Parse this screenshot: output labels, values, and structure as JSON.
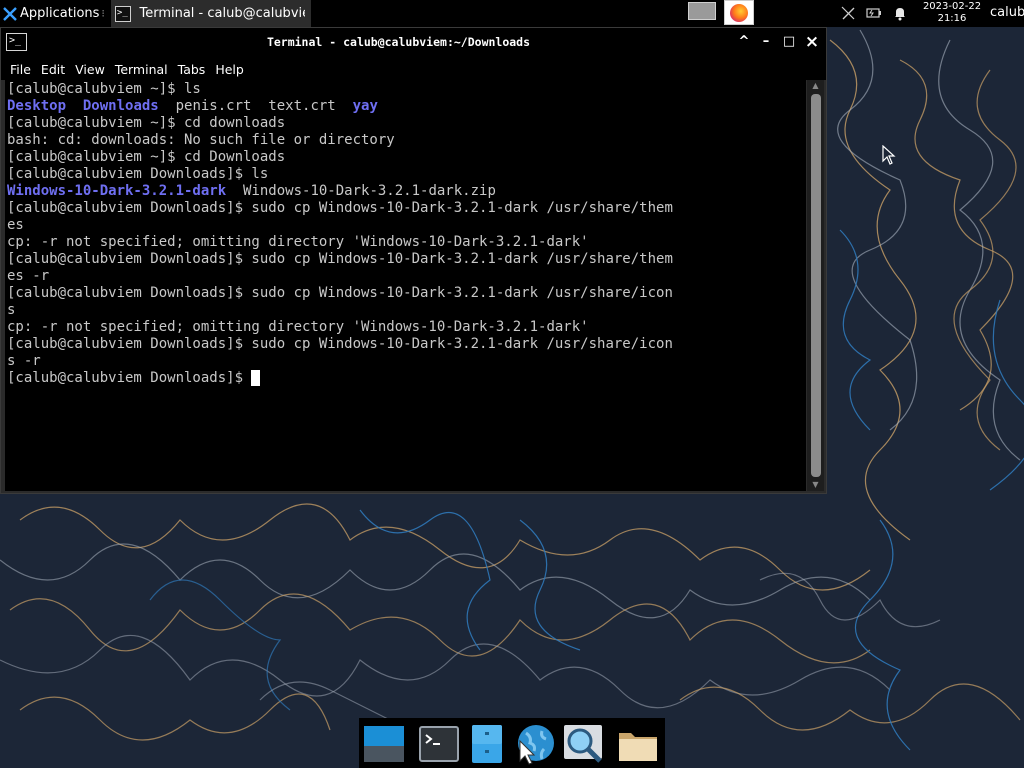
{
  "panel": {
    "applications_label": "Applications",
    "task_label": "Terminal - calub@calubvie...",
    "clock_date": "2023-02-22",
    "clock_time": "21:16",
    "user": "calub"
  },
  "window": {
    "title": "Terminal - calub@calubviem:~/Downloads",
    "menu": [
      "File",
      "Edit",
      "View",
      "Terminal",
      "Tabs",
      "Help"
    ],
    "controls": {
      "up": "^",
      "minimize": "–",
      "maximize": "□",
      "close": "×"
    }
  },
  "terminal": {
    "lines": [
      [
        {
          "t": "[calub@calubviem ~]$ ls",
          "c": "n"
        }
      ],
      [
        {
          "t": "Desktop",
          "c": "b"
        },
        {
          "t": "  ",
          "c": "n"
        },
        {
          "t": "Downloads",
          "c": "b"
        },
        {
          "t": "  penis.crt  text.crt  ",
          "c": "n"
        },
        {
          "t": "yay",
          "c": "b"
        }
      ],
      [
        {
          "t": "[calub@calubviem ~]$ cd downloads",
          "c": "n"
        }
      ],
      [
        {
          "t": "bash: cd: downloads: No such file or directory",
          "c": "n"
        }
      ],
      [
        {
          "t": "[calub@calubviem ~]$ cd Downloads",
          "c": "n"
        }
      ],
      [
        {
          "t": "[calub@calubviem Downloads]$ ls",
          "c": "n"
        }
      ],
      [
        {
          "t": "Windows-10-Dark-3.2.1-dark",
          "c": "b"
        },
        {
          "t": "  Windows-10-Dark-3.2.1-dark.zip",
          "c": "n"
        }
      ],
      [
        {
          "t": "[calub@calubviem Downloads]$ sudo cp Windows-10-Dark-3.2.1-dark /usr/share/them",
          "c": "n"
        }
      ],
      [
        {
          "t": "es",
          "c": "n"
        }
      ],
      [
        {
          "t": "cp: -r not specified; omitting directory 'Windows-10-Dark-3.2.1-dark'",
          "c": "n"
        }
      ],
      [
        {
          "t": "[calub@calubviem Downloads]$ sudo cp Windows-10-Dark-3.2.1-dark /usr/share/them",
          "c": "n"
        }
      ],
      [
        {
          "t": "es -r",
          "c": "n"
        }
      ],
      [
        {
          "t": "[calub@calubviem Downloads]$ sudo cp Windows-10-Dark-3.2.1-dark /usr/share/icon",
          "c": "n"
        }
      ],
      [
        {
          "t": "s",
          "c": "n"
        }
      ],
      [
        {
          "t": "cp: -r not specified; omitting directory 'Windows-10-Dark-3.2.1-dark'",
          "c": "n"
        }
      ],
      [
        {
          "t": "[calub@calubviem Downloads]$ sudo cp Windows-10-Dark-3.2.1-dark /usr/share/icon",
          "c": "n"
        }
      ],
      [
        {
          "t": "s -r",
          "c": "n"
        }
      ],
      [
        {
          "t": "[calub@calubviem Downloads]$ ",
          "c": "n",
          "cursor": true
        }
      ]
    ]
  },
  "icons": {
    "apps_menu": "xfce-mouse-icon",
    "task": "terminal-icon",
    "workspace": "workspace-switcher",
    "browser": "firefox-icon",
    "tray": [
      "network-disconnected-icon",
      "battery-icon",
      "notification-bell-icon"
    ],
    "dock": [
      "show-desktop-icon",
      "terminal-icon",
      "file-manager-icon",
      "web-browser-icon",
      "search-app-icon",
      "folder-icon"
    ]
  },
  "colors": {
    "terminal_bg": "#000000",
    "terminal_fg": "#c8c8c8",
    "dir_color": "#6f6ff2",
    "desktop_bg": "#1c2637",
    "pattern_orange": "#c9a067",
    "pattern_blue": "#2f78b8"
  }
}
